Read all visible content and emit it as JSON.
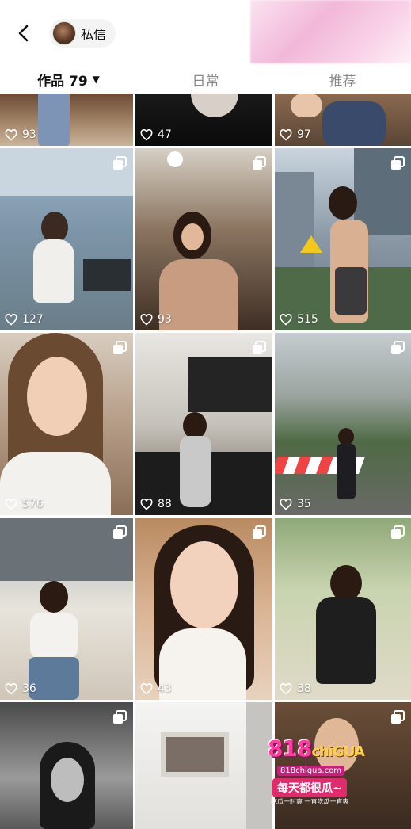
{
  "header": {
    "back_icon": "chevron-left-icon",
    "chat_label": "私信"
  },
  "tabs": [
    {
      "label": "作品 79",
      "active": true,
      "caret": "▼"
    },
    {
      "label": "日常",
      "active": false
    },
    {
      "label": "推荐",
      "active": false
    }
  ],
  "grid": {
    "row0": [
      "93",
      "47",
      "97"
    ],
    "row1": [
      "127",
      "93",
      "515"
    ],
    "row2": [
      "576",
      "88",
      "35"
    ],
    "row3": [
      "36",
      "43",
      "38"
    ]
  },
  "promo": {
    "logo_main": "818",
    "logo_sub": "chiGUA",
    "url": "818chigua.com",
    "slogan": "每天都很瓜~",
    "small": "吃瓜一时爽 一直吃瓜一直爽"
  },
  "colors": {
    "accent": "#ff3ca0",
    "text_primary": "#111111",
    "text_secondary": "#888888"
  }
}
